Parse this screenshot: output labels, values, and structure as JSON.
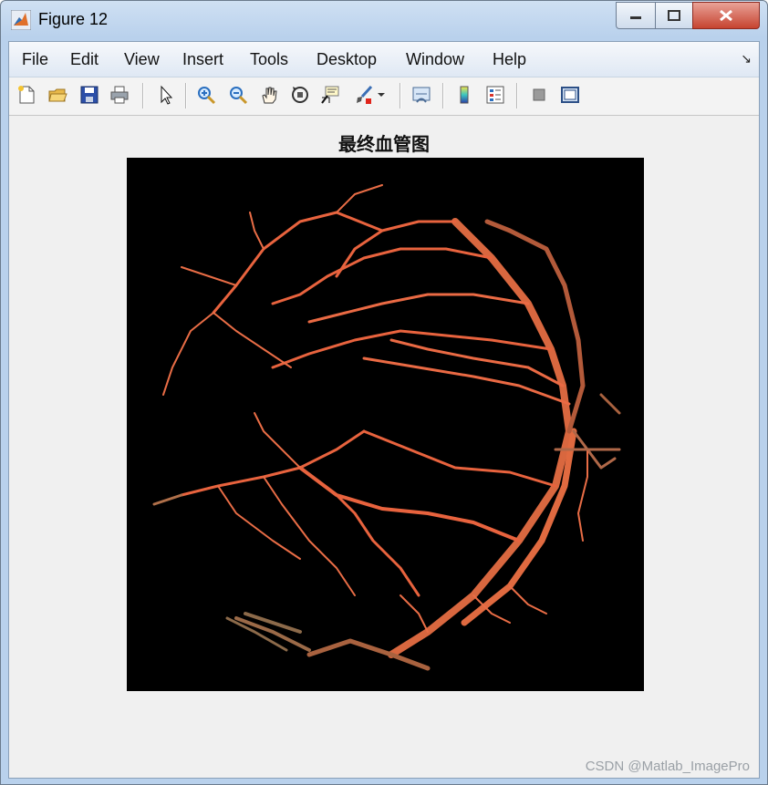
{
  "window": {
    "title": "Figure 12"
  },
  "menubar": {
    "items": [
      "File",
      "Edit",
      "View",
      "Insert",
      "Tools",
      "Desktop",
      "Window",
      "Help"
    ]
  },
  "toolbar": {
    "buttons": [
      "new-figure-icon",
      "open-file-icon",
      "save-icon",
      "print-icon",
      "pointer-icon",
      "zoom-in-icon",
      "zoom-out-icon",
      "pan-hand-icon",
      "rotate-3d-icon",
      "data-cursor-icon",
      "brush-icon",
      "link-plot-icon",
      "colorbar-icon",
      "legend-icon",
      "hide-plot-tools-icon",
      "show-plot-tools-icon"
    ]
  },
  "figure": {
    "title": "最终血管图",
    "background": "#000000",
    "vessel_color": "#e2683f"
  },
  "watermark": "CSDN @Matlab_ImagePro"
}
